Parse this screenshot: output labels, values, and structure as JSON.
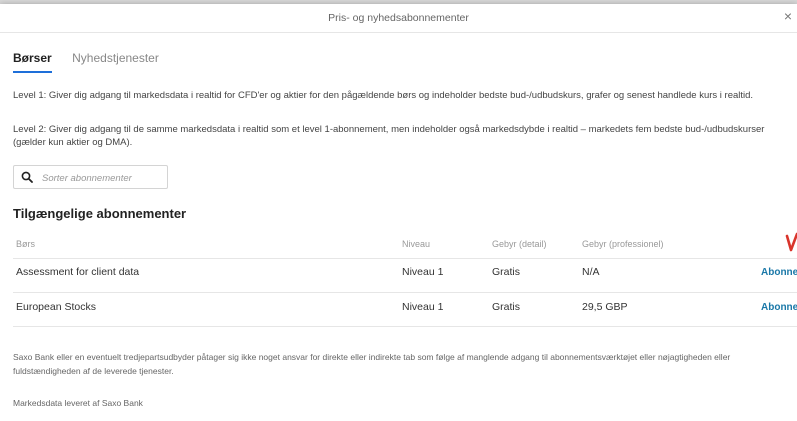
{
  "dialog": {
    "title": "Pris- og nyhedsabonnementer",
    "close_glyph": "×"
  },
  "tabs": [
    {
      "label": "Børser",
      "active": true
    },
    {
      "label": "Nyhedstjenester",
      "active": false
    }
  ],
  "descriptions": {
    "level1": "Level 1: Giver dig adgang til markedsdata i realtid for CFD'er og aktier for den pågældende børs og indeholder bedste bud-/udbudskurs, grafer og senest handlede kurs i realtid.",
    "level2_line1": "Level 2: Giver dig adgang til de samme markedsdata i realtid som et level 1-abonnement, men indeholder også markedsdybde i realtid – markedets fem bedste bud-/udbudskurser",
    "level2_line2": "(gælder kun aktier og DMA)."
  },
  "search": {
    "placeholder": "Sorter abonnementer",
    "value": ""
  },
  "section_title": "Tilgængelige abonnementer",
  "table": {
    "headers": {
      "exchange": "Børs",
      "level": "Niveau",
      "fee_retail": "Gebyr (detail)",
      "fee_professional": "Gebyr (professionel)"
    },
    "rows": [
      {
        "exchange": "Assessment for client data",
        "level": "Niveau 1",
        "fee_retail": "Gratis",
        "fee_professional": "N/A",
        "action": "Abonner"
      },
      {
        "exchange": "European Stocks",
        "level": "Niveau 1",
        "fee_retail": "Gratis",
        "fee_professional": "29,5 GBP",
        "action": "Abonner"
      }
    ]
  },
  "footer": {
    "disclaimer_line1": "Saxo Bank eller en eventuelt tredjepartsudbyder påtager sig ikke noget ansvar for direkte eller indirekte tab som følge af manglende adgang til abonnementsværktøjet eller nøjagtigheden eller",
    "disclaimer_line2": "fuldstændigheden af de leverede tjenester.",
    "provider": "Markedsdata leveret af Saxo Bank"
  },
  "colors": {
    "accent": "#1e6fd9",
    "link": "#1a78a8",
    "annotation": "#d9342b"
  }
}
